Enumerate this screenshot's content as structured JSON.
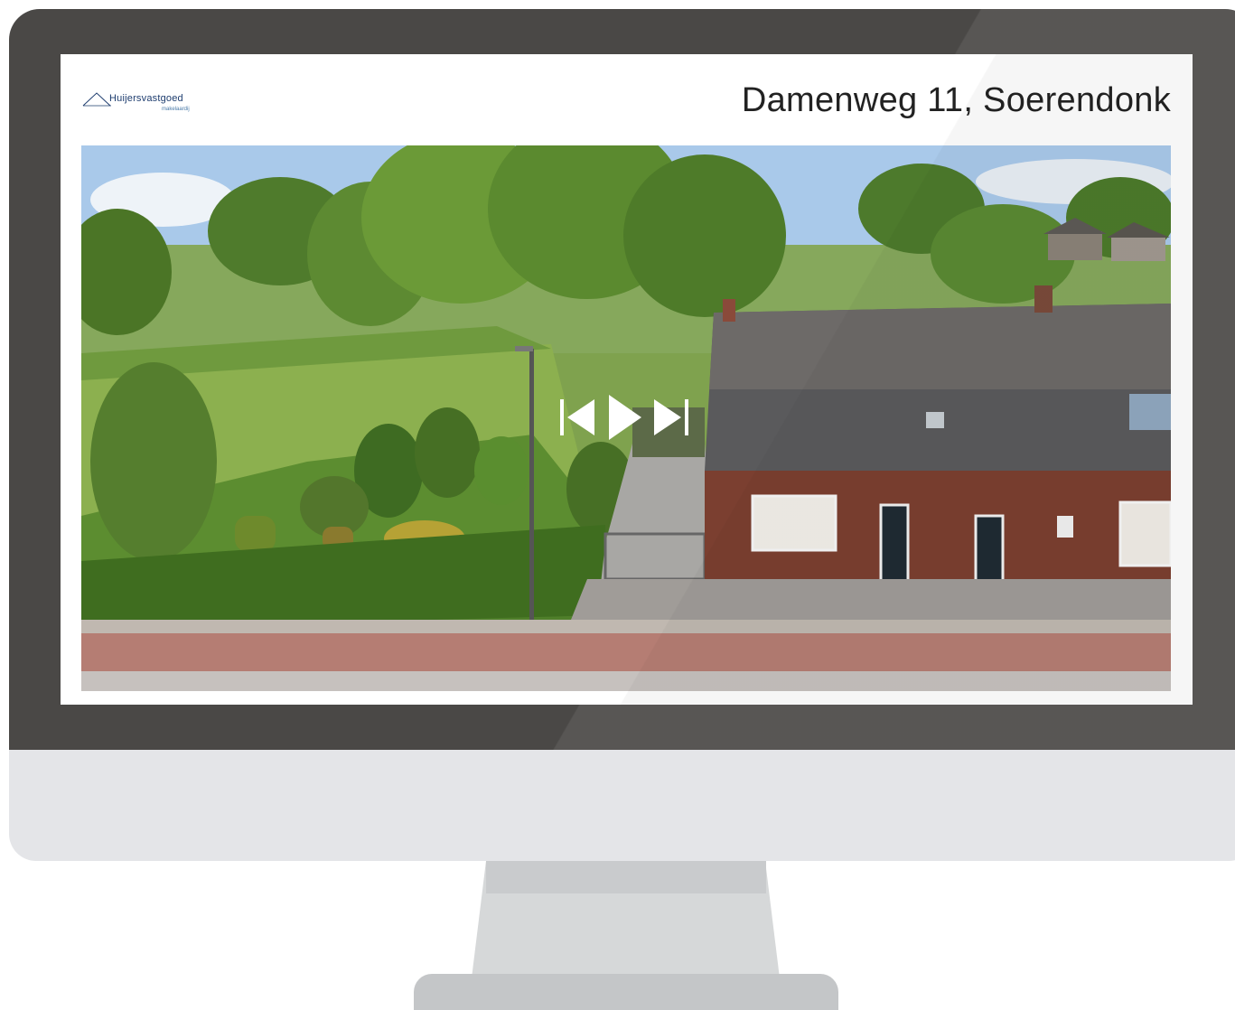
{
  "brand": {
    "logo_name": "Huijersvastgoed",
    "logo_tagline": "makelaardij"
  },
  "listing": {
    "title": "Damenweg 11, Soerendonk"
  },
  "slideshow": {
    "controls": [
      {
        "name": "previous",
        "icon": "skip-previous-icon"
      },
      {
        "name": "play",
        "icon": "play-icon"
      },
      {
        "name": "next",
        "icon": "skip-next-icon"
      }
    ]
  },
  "colors": {
    "bezel": "#4a4846",
    "chin": "#e4e5e8",
    "brand_blue": "#1d3c6e",
    "title_text": "#222222"
  }
}
